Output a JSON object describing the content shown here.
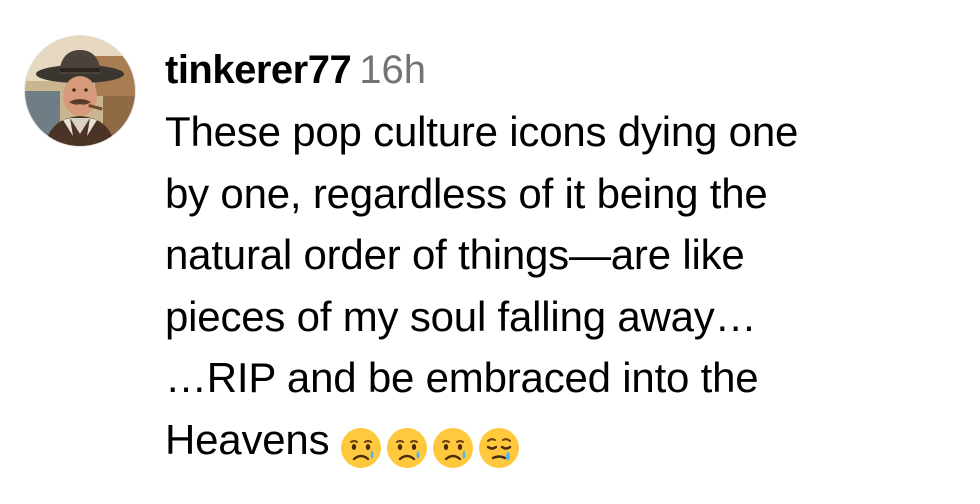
{
  "comment": {
    "username": "tinkerer77",
    "timestamp": "16h",
    "lines": [
      "These pop culture icons dying one",
      "by one, regardless of it being the",
      "natural order of things—are like",
      "pieces of my soul falling away…",
      "…RIP and be embraced into the",
      "Heavens"
    ],
    "emojis": [
      "crying-face-icon",
      "crying-face-icon",
      "crying-face-icon",
      "sleepy-face-icon"
    ]
  }
}
